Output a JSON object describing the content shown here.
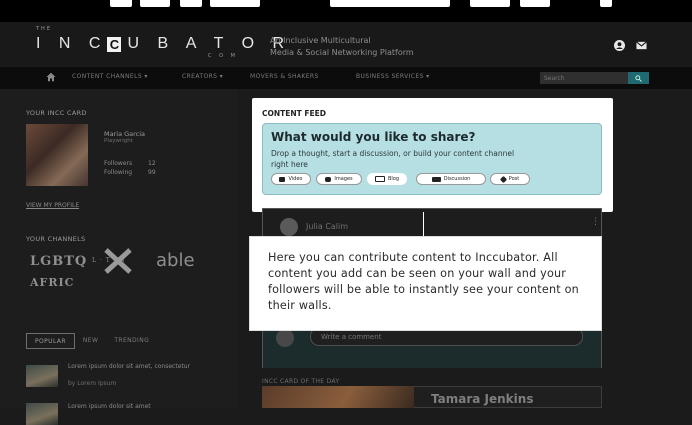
{
  "header": {
    "logo_the": "THE",
    "logo_text_1": "I N C",
    "logo_box_letter": "C",
    "logo_text_2": "U B A T O R",
    "logo_com": "C O M",
    "tagline_1": "An Inclusive Multicultural",
    "tagline_2": "Media & Social Networking Platform"
  },
  "nav": {
    "items": [
      "CONTENT CHANNELS ▾",
      "CREATORS ▾",
      "MOVERS & SHAKERS",
      "BUSINESS SERVICES ▾"
    ],
    "search_placeholder": "Search"
  },
  "sidebar": {
    "card_title": "YOUR INCC CARD",
    "name": "Maria Garcia",
    "role": "Playwright",
    "followers_label": "Followers",
    "followers_count": "12",
    "following_label": "Following",
    "following_count": "99",
    "view_profile": "VIEW MY PROFILE",
    "channels_title": "YOUR CHANNELS",
    "channels": [
      "LGBTQ",
      "L · T · N",
      "able",
      "AFRIC"
    ],
    "tabs": [
      "POPULAR",
      "NEW",
      "TRENDING"
    ],
    "articles": [
      {
        "title": "Lorem ipsum dolor sit amet, consectetur",
        "by": "by Lorem Ipsum"
      },
      {
        "title": "Lorem ipsum dolor sit amet",
        "by": ""
      }
    ]
  },
  "feed": {
    "label": "CONTENT FEED",
    "share_title": "What would you like to share?",
    "share_sub": "Drop a thought, start a discussion, or build your content channel right here",
    "buttons": [
      "Video",
      "Images",
      "Blog",
      "Discussion",
      "Post"
    ],
    "post_user": "Julia Calim",
    "comment_placeholder": "Write a comment",
    "tooltip": "Here you can contribute content to Inccubator. All content you add can be seen on your wall and your followers will be able to instantly see your content on their walls.",
    "card_of_day_label": "INCC CARD OF THE DAY",
    "card_of_day_name": "Tamara Jenkins"
  }
}
